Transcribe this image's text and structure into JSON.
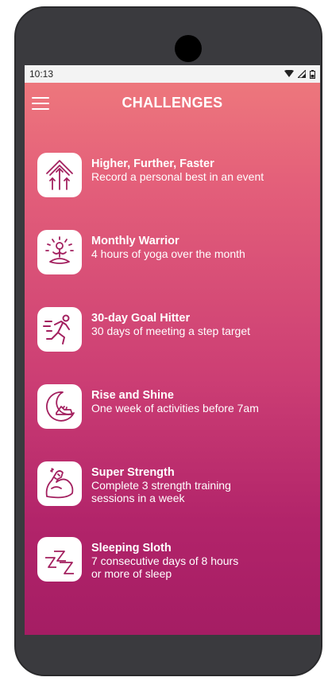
{
  "status": {
    "time": "10:13"
  },
  "header": {
    "title": "CHALLENGES"
  },
  "challenges": [
    {
      "title": "Higher, Further, Faster",
      "description": "Record a personal best in an event",
      "icon": "arrows-up-icon"
    },
    {
      "title": "Monthly Warrior",
      "description": "4 hours of yoga over the month",
      "icon": "yoga-icon"
    },
    {
      "title": "30-day Goal Hitter",
      "description": "30 days of meeting a step target",
      "icon": "runner-icon"
    },
    {
      "title": "Rise and Shine",
      "description": "One week of activities before 7am",
      "icon": "moon-shoe-icon"
    },
    {
      "title": "Super Strength",
      "description": "Complete 3 strength training\nsessions in a week",
      "icon": "bicep-icon"
    },
    {
      "title": "Sleeping Sloth",
      "description": "7 consecutive days of 8 hours\nor more of sleep",
      "icon": "zzz-icon"
    }
  ],
  "colors": {
    "icon_stroke": "#a3205f",
    "gradient_top": "#ef7b7d",
    "gradient_bottom": "#a51d64"
  }
}
